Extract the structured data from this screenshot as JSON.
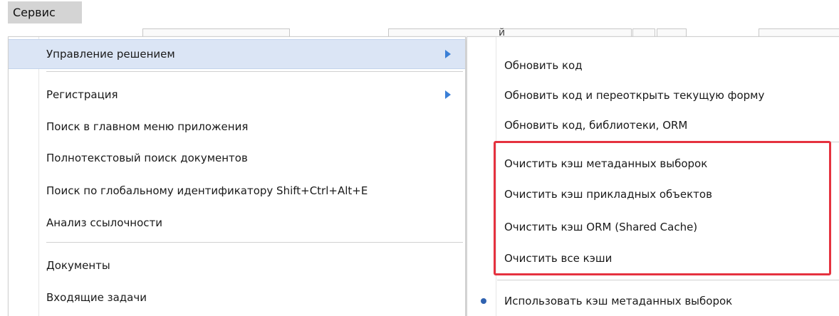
{
  "menubar": {
    "service_label": "Сервис"
  },
  "background": {
    "partial_text": "й"
  },
  "main_menu": {
    "items": [
      {
        "label": "Управление решением",
        "has_submenu": true,
        "active": true
      },
      {
        "label": "Регистрация",
        "has_submenu": true,
        "active": false
      },
      {
        "label": "Поиск в главном меню приложения",
        "has_submenu": false,
        "active": false
      },
      {
        "label": "Полнотекстовый поиск документов",
        "has_submenu": false,
        "active": false
      },
      {
        "label": "Поиск по глобальному идентификатору Shift+Ctrl+Alt+E",
        "has_submenu": false,
        "active": false
      },
      {
        "label": "Анализ ссылочности",
        "has_submenu": false,
        "active": false
      },
      {
        "label": "Документы",
        "has_submenu": false,
        "active": false
      },
      {
        "label": "Входящие задачи",
        "has_submenu": false,
        "active": false
      }
    ]
  },
  "submenu": {
    "items": [
      {
        "label": "Обновить код"
      },
      {
        "label": "Обновить код и переоткрыть текущую форму"
      },
      {
        "label": "Обновить код, библиотеки, ORM"
      },
      {
        "label": "Очистить кэш метаданных выборок"
      },
      {
        "label": "Очистить кэш прикладных объектов"
      },
      {
        "label": "Очистить кэш ORM (Shared Cache)"
      },
      {
        "label": "Очистить все кэши"
      },
      {
        "label": "Использовать кэш метаданных выборок",
        "checked": true
      }
    ]
  },
  "colors": {
    "active_item_bg": "#dbe5f5",
    "submenu_arrow": "#3a7fd6",
    "highlight_border": "#e5323f",
    "radio_dot": "#2f62b0"
  }
}
